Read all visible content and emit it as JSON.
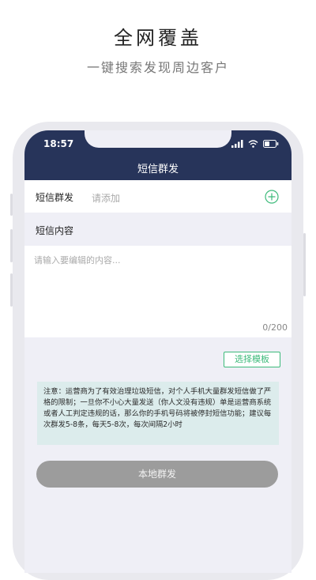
{
  "promo": {
    "title": "全网覆盖",
    "subtitle": "一键搜索发现周边客户"
  },
  "status_bar": {
    "time": "18:57",
    "icons": [
      "signal-icon",
      "wifi-icon",
      "battery-icon"
    ]
  },
  "nav": {
    "title": "短信群发"
  },
  "recipient": {
    "label": "短信群发",
    "placeholder": "请添加",
    "add_icon": "plus-circle-icon"
  },
  "content": {
    "label": "短信内容",
    "placeholder": "请输入要编辑的内容...",
    "counter": "0/200"
  },
  "template_button": {
    "label": "选择模板"
  },
  "notice": {
    "text": "注意：运营商为了有效治理垃圾短信，对个人手机大量群发短信做了严格的限制；一旦你不小心大量发送（你人文没有违规）单是运营商系统或者人工判定违规的话，那么你的手机号码将被停封短信功能；建议每次群发5-8条，每天5-8次，每次间隔2小时"
  },
  "send_button": {
    "label": "本地群发"
  },
  "colors": {
    "nav_bg": "#27345a",
    "accent_green": "#3cba7a",
    "notice_bg": "#dcecec",
    "button_gray": "#9c9c9c"
  }
}
